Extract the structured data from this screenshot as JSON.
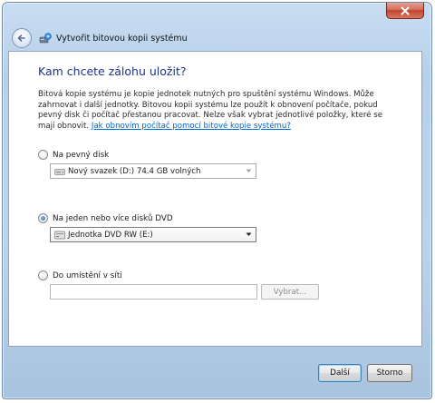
{
  "window": {
    "title": "Vytvořit bitovou kopii systému",
    "accent": "#1e3287",
    "link_color": "#0066cc"
  },
  "icons": {
    "close": "close-icon",
    "back": "back-arrow-icon",
    "app": "backup-icon",
    "drive": "hard-disk-icon",
    "dvd": "dvd-drive-icon"
  },
  "content": {
    "heading": "Kam chcete zálohu uložit?",
    "description": "Bitová kopie systému je kopie jednotek nutných pro spuštění systému Windows. Může zahrnovat i další jednotky. Bitovou kopii systému lze použít k obnovení počítače, pokud pevný disk či počítač přestanou pracovat. Nelze však vybrat jednotlivé položky, které se mají obnovit.",
    "help_link": "Jak obnovím počítač pomocí bitové kopie systému?"
  },
  "options": {
    "hard_disk": {
      "label": "Na pevný disk",
      "selected": false,
      "value": "Nový svazek (D:)  74.4 GB volných"
    },
    "dvd": {
      "label": "Na jeden nebo více disků DVD",
      "selected": true,
      "value": "Jednotka DVD RW (E:)"
    },
    "network": {
      "label": "Do umístění v síti",
      "selected": false,
      "value": "",
      "browse_label": "Vybrat..."
    }
  },
  "footer": {
    "next_label": "Další",
    "cancel_label": "Storno"
  }
}
